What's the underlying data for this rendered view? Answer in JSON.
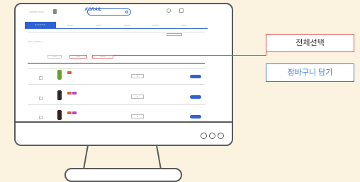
{
  "callouts": {
    "select_all": "전체선택",
    "add_to_cart": "장바구니 담기"
  },
  "colors": {
    "background": "#fbf2e0",
    "brand_blue": "#2f62d4",
    "highlight_red": "#e24c4c"
  },
  "site": {
    "logo": "KORAIL"
  },
  "icons": [
    "search-icon",
    "cart-icon",
    "menu-icon",
    "monitor-power-dots"
  ]
}
